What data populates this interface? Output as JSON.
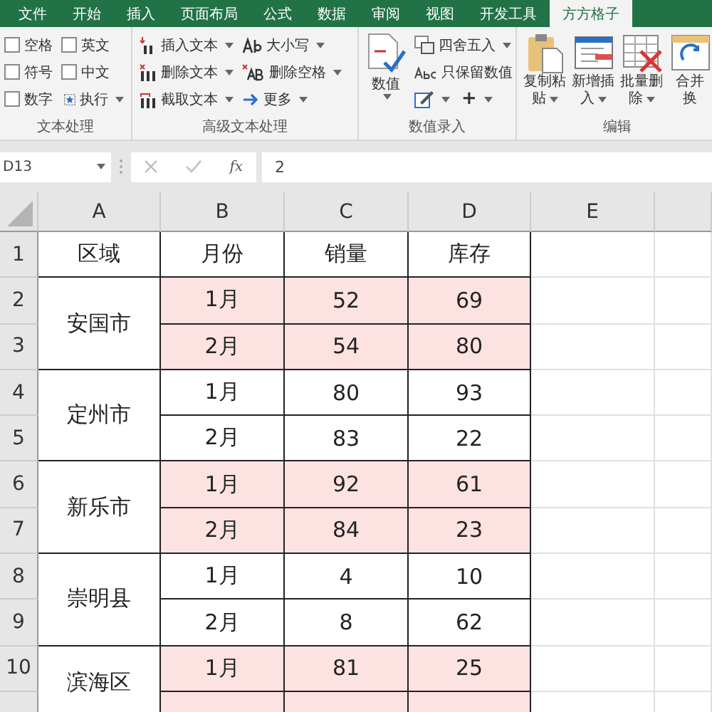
{
  "tabs": [
    {
      "label": "文件",
      "selected": false
    },
    {
      "label": "开始",
      "selected": false
    },
    {
      "label": "插入",
      "selected": false
    },
    {
      "label": "页面布局",
      "selected": false
    },
    {
      "label": "公式",
      "selected": false
    },
    {
      "label": "数据",
      "selected": false
    },
    {
      "label": "审阅",
      "selected": false
    },
    {
      "label": "视图",
      "selected": false
    },
    {
      "label": "开发工具",
      "selected": false
    },
    {
      "label": "方方格子",
      "selected": true
    }
  ],
  "ribbon": {
    "text_group": {
      "label": "文本处理",
      "checkboxes": [
        {
          "label": "空格",
          "checked": false
        },
        {
          "label": "符号",
          "checked": false
        },
        {
          "label": "数字",
          "checked": false
        },
        {
          "label": "英文",
          "checked": false
        },
        {
          "label": "中文",
          "checked": false
        }
      ],
      "run_button": "执行"
    },
    "advanced_group": {
      "label": "高级文本处理",
      "items": [
        {
          "label": "插入文本",
          "kind": "insert"
        },
        {
          "label": "删除文本",
          "kind": "delete"
        },
        {
          "label": "截取文本",
          "kind": "extract"
        },
        {
          "label": "大小写",
          "kind": "case"
        },
        {
          "label": "删除空格",
          "kind": "space"
        },
        {
          "label": "更多",
          "kind": "more"
        }
      ]
    },
    "number_group": {
      "label": "数值录入",
      "big_button": "数值",
      "round_button": "四舍五入",
      "keep_button": "只保留数值",
      "plus_button": "+"
    },
    "edit_group": {
      "label": "编辑",
      "buttons": [
        {
          "lines": [
            "复制粘",
            "贴"
          ],
          "kind": "paste"
        },
        {
          "lines": [
            "新增插",
            "入"
          ],
          "kind": "insert"
        },
        {
          "lines": [
            "批量删",
            "除"
          ],
          "kind": "delete"
        },
        {
          "lines": [
            "合并",
            "换"
          ],
          "kind": "merge"
        }
      ]
    }
  },
  "formula_bar": {
    "name_box": "D13",
    "fx_label": "fx",
    "value": "2"
  },
  "columns": [
    "A",
    "B",
    "C",
    "D",
    "E"
  ],
  "header_row": {
    "row_number": "1",
    "cells": [
      "区域",
      "月份",
      "销量",
      "库存"
    ]
  },
  "groups": [
    {
      "region": "安国市",
      "highlighted": true,
      "rows": [
        {
          "row_number": "2",
          "month": "1月",
          "sales": "52",
          "stock": "69"
        },
        {
          "row_number": "3",
          "month": "2月",
          "sales": "54",
          "stock": "80"
        }
      ]
    },
    {
      "region": "定州市",
      "highlighted": false,
      "rows": [
        {
          "row_number": "4",
          "month": "1月",
          "sales": "80",
          "stock": "93"
        },
        {
          "row_number": "5",
          "month": "2月",
          "sales": "83",
          "stock": "22"
        }
      ]
    },
    {
      "region": "新乐市",
      "highlighted": true,
      "rows": [
        {
          "row_number": "6",
          "month": "1月",
          "sales": "92",
          "stock": "61"
        },
        {
          "row_number": "7",
          "month": "2月",
          "sales": "84",
          "stock": "23"
        }
      ]
    },
    {
      "region": "崇明县",
      "highlighted": false,
      "rows": [
        {
          "row_number": "8",
          "month": "1月",
          "sales": "4",
          "stock": "10"
        },
        {
          "row_number": "9",
          "month": "2月",
          "sales": "8",
          "stock": "62"
        }
      ]
    },
    {
      "region": "滨海区",
      "highlighted": true,
      "rows": [
        {
          "row_number": "10",
          "month": "1月",
          "sales": "81",
          "stock": "25"
        }
      ]
    }
  ]
}
